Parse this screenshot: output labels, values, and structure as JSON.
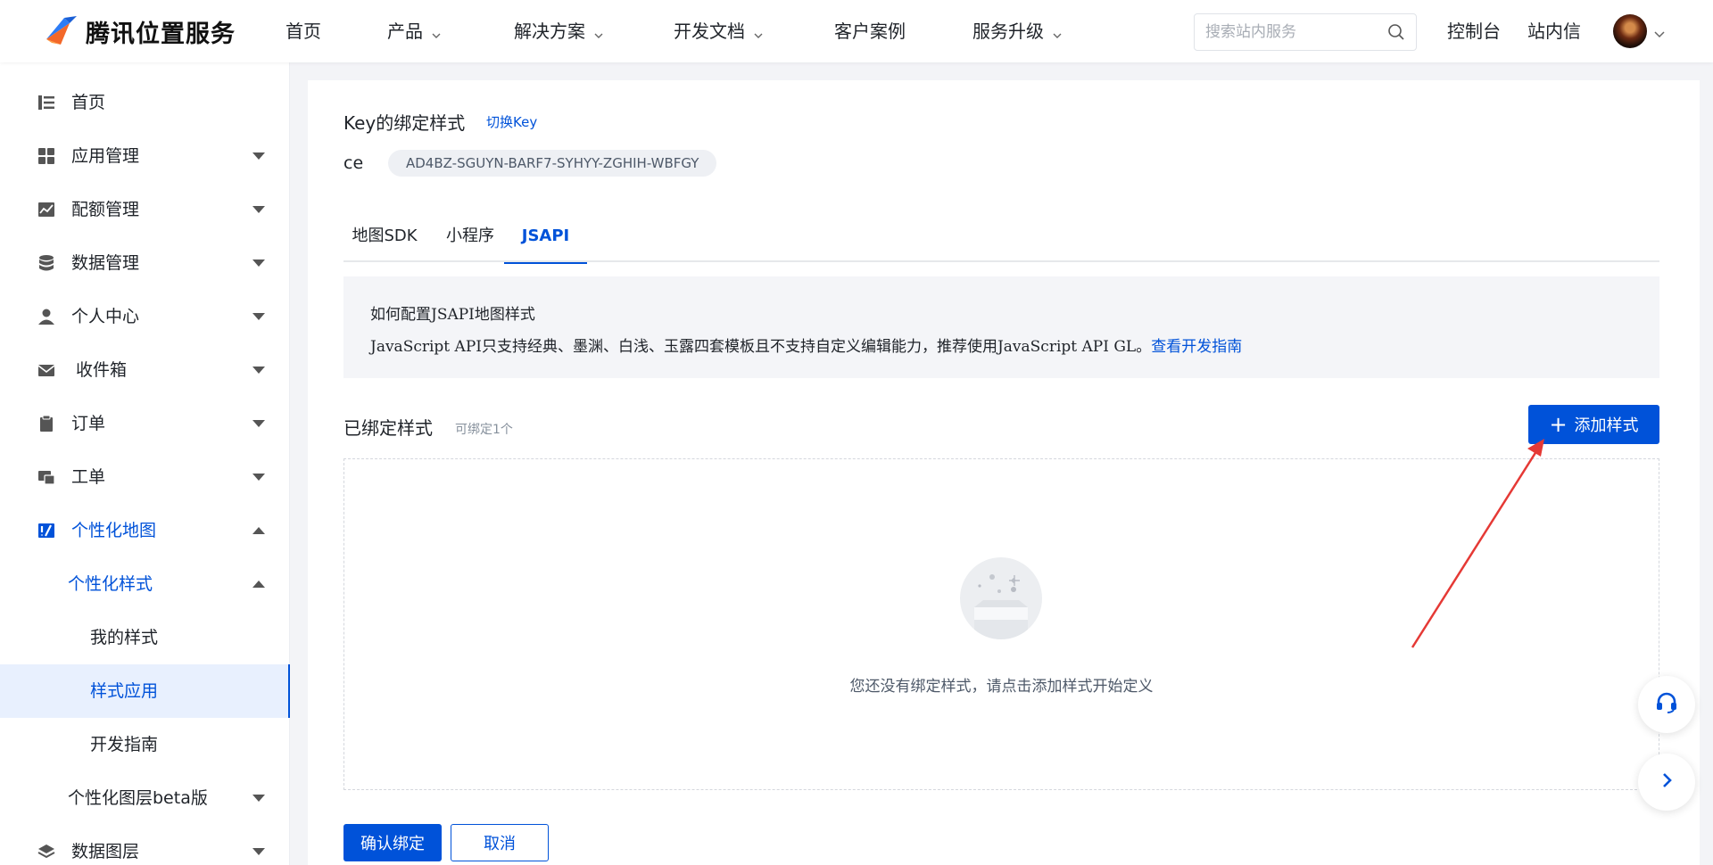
{
  "header": {
    "logo_text": "腾讯位置服务",
    "nav": [
      {
        "label": "首页",
        "has_dropdown": false
      },
      {
        "label": "产品",
        "has_dropdown": true
      },
      {
        "label": "解决方案",
        "has_dropdown": true
      },
      {
        "label": "开发文档",
        "has_dropdown": true
      },
      {
        "label": "客户案例",
        "has_dropdown": false
      },
      {
        "label": "服务升级",
        "has_dropdown": true
      }
    ],
    "search_placeholder": "搜索站内服务",
    "console_label": "控制台",
    "messages_label": "站内信"
  },
  "sidebar": {
    "items": [
      {
        "label": "首页",
        "icon": "list-icon"
      },
      {
        "label": "应用管理",
        "icon": "grid-icon"
      },
      {
        "label": "配额管理",
        "icon": "chart-icon"
      },
      {
        "label": "数据管理",
        "icon": "database-icon"
      },
      {
        "label": "个人中心",
        "icon": "user-icon"
      },
      {
        "label": "收件箱",
        "icon": "mail-icon"
      },
      {
        "label": "订单",
        "icon": "clipboard-icon"
      },
      {
        "label": "工单",
        "icon": "ticket-icon"
      },
      {
        "label": "个性化地图",
        "icon": "map-style-icon"
      },
      {
        "label": "个性化样式"
      },
      {
        "label": "我的样式"
      },
      {
        "label": "样式应用"
      },
      {
        "label": "开发指南"
      },
      {
        "label": "个性化图层beta版"
      },
      {
        "label": "数据图层",
        "icon": "layers-icon"
      }
    ]
  },
  "main": {
    "key_title": "Key的绑定样式",
    "switch_key": "切换Key",
    "key_name": "ce",
    "key_value": "AD4BZ-SGUYN-BARF7-SYHYY-ZGHIH-WBFGY",
    "tabs": [
      {
        "label": "地图SDK"
      },
      {
        "label": "小程序"
      },
      {
        "label": "JSAPI"
      }
    ],
    "active_tab": "JSAPI",
    "info": {
      "title": "如何配置JSAPI地图样式",
      "text": "JavaScript API只支持经典、墨渊、白浅、玉露四套模板且不支持自定义编辑能力，推荐使用JavaScript API GL。",
      "link": "查看开发指南"
    },
    "bound_title": "已绑定样式",
    "bound_sub": "可绑定1个",
    "add_button": "添加样式",
    "empty_text": "您还没有绑定样式，请点击添加样式开始定义",
    "confirm_button": "确认绑定",
    "cancel_button": "取消"
  },
  "floating": {
    "support_icon": "headset-icon",
    "next_icon": "chevron-right-icon"
  },
  "colors": {
    "primary": "#0052d9",
    "annotation_arrow": "#e53935"
  }
}
